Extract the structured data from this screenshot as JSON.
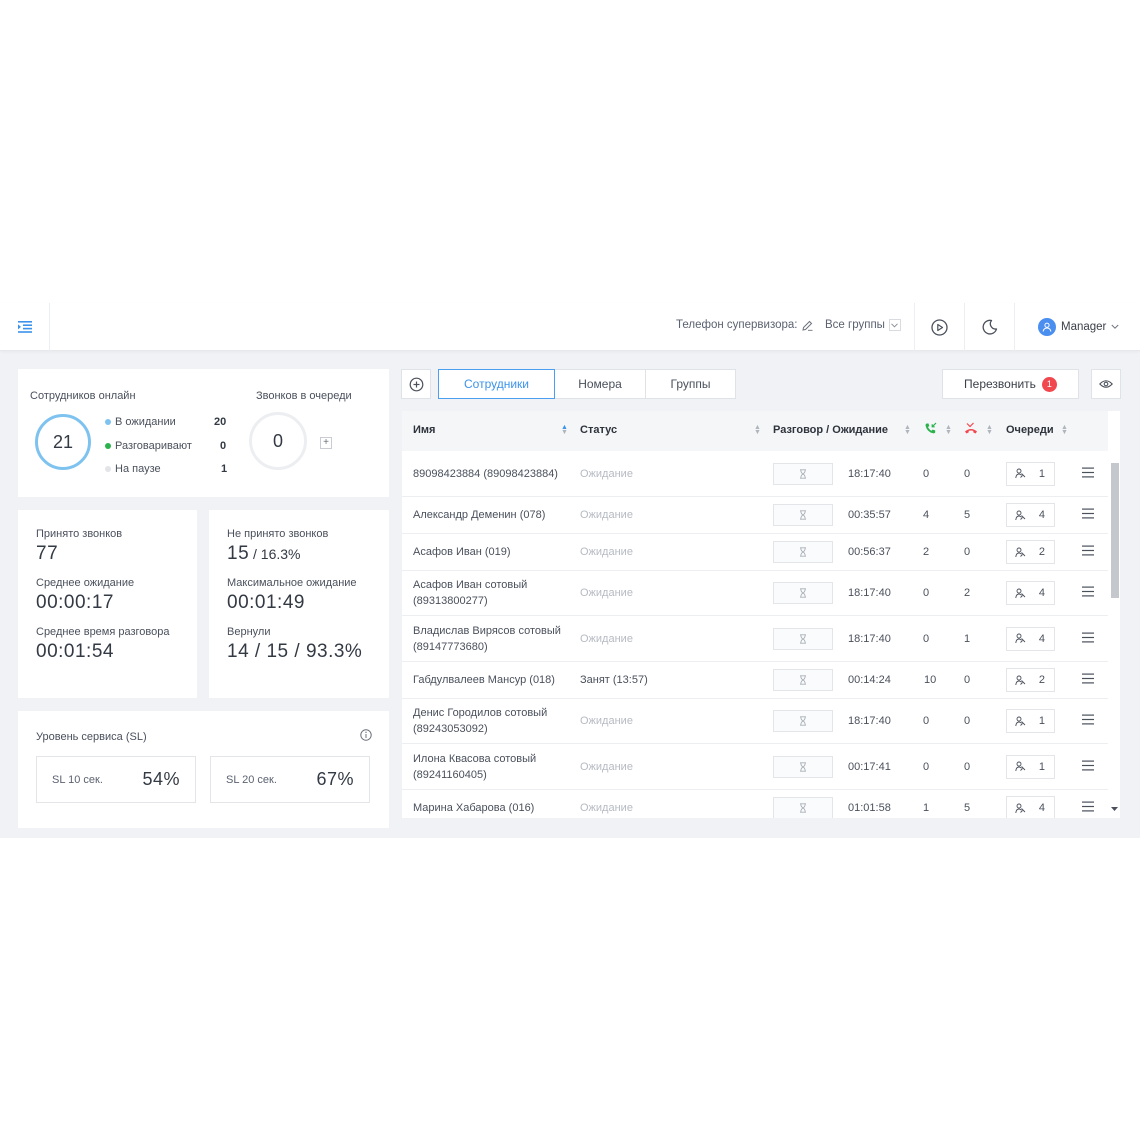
{
  "topbar": {
    "supervisor_phone_label": "Телефон супервизора:",
    "groups_select_value": "Все группы",
    "user_name": "Manager"
  },
  "online": {
    "title": "Сотрудников онлайн",
    "total": "21",
    "legend": [
      {
        "label": "В ожидании",
        "value": "20",
        "color": "#7ec3ef"
      },
      {
        "label": "Разговаривают",
        "value": "0",
        "color": "#2bb24c"
      },
      {
        "label": "На паузе",
        "value": "1",
        "color": "#e2e4e8"
      }
    ],
    "queue_title": "Звонков в очереди",
    "queue_value": "0",
    "plus_label": "+"
  },
  "accepted": {
    "received_label": "Принято звонков",
    "received_value": "77",
    "avg_wait_label": "Среднее ожидание",
    "avg_wait_value": "00:00:17",
    "avg_talk_label": "Среднее время разговора",
    "avg_talk_value": "00:01:54"
  },
  "missed": {
    "missed_label": "Не принято звонков",
    "missed_value": "15",
    "missed_pct": " / 16.3%",
    "max_wait_label": "Максимальное ожидание",
    "max_wait_value": "00:01:49",
    "returned_label": "Вернули",
    "returned_value": "14 / 15 / 93.3%"
  },
  "service_level": {
    "title": "Уровень сервиса (SL)",
    "sl10_label": "SL 10 сек.",
    "sl10_value": "54%",
    "sl20_label": "SL 20 сек.",
    "sl20_value": "67%"
  },
  "tabs": [
    "Сотрудники",
    "Номера",
    "Группы"
  ],
  "recall": {
    "label": "Перезвонить",
    "badge": "1"
  },
  "table": {
    "headers": {
      "name": "Имя",
      "status": "Статус",
      "talk_wait": "Разговор / Ожидание",
      "queues": "Очереди"
    },
    "rows": [
      {
        "name": "89098423884 (89098423884)",
        "status": "Ожидание",
        "time": "18:17:40",
        "answered": "0",
        "missed": "0",
        "queues": "1"
      },
      {
        "name": "Александр Деменин (078)",
        "status": "Ожидание",
        "time": "00:35:57",
        "answered": "4",
        "missed": "5",
        "queues": "4"
      },
      {
        "name": "Асафов Иван (019)",
        "status": "Ожидание",
        "time": "00:56:37",
        "answered": "2",
        "missed": "0",
        "queues": "2"
      },
      {
        "name": "Асафов Иван сотовый (89313800277)",
        "status": "Ожидание",
        "time": "18:17:40",
        "answered": "0",
        "missed": "2",
        "queues": "4"
      },
      {
        "name": "Владислав Вирясов сотовый (89147773680)",
        "status": "Ожидание",
        "time": "18:17:40",
        "answered": "0",
        "missed": "1",
        "queues": "4"
      },
      {
        "name": "Габдулвалеев Мансур (018)",
        "status": "Занят (13:57)",
        "time": "00:14:24",
        "answered": "10",
        "missed": "0",
        "queues": "2"
      },
      {
        "name": "Денис Городилов сотовый (89243053092)",
        "status": "Ожидание",
        "time": "18:17:40",
        "answered": "0",
        "missed": "0",
        "queues": "1"
      },
      {
        "name": "Илона Квасова сотовый (89241160405)",
        "status": "Ожидание",
        "time": "00:17:41",
        "answered": "0",
        "missed": "0",
        "queues": "1"
      },
      {
        "name": "Марина Хабарова (016)",
        "status": "Ожидание",
        "time": "01:01:58",
        "answered": "1",
        "missed": "5",
        "queues": "4"
      }
    ]
  }
}
